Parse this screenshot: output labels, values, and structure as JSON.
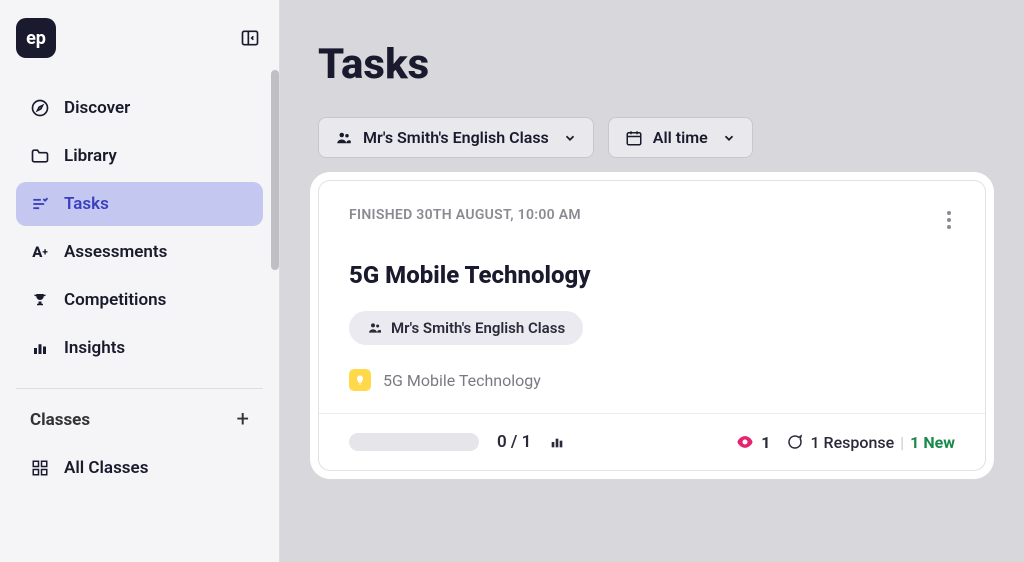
{
  "logo": "ep",
  "sidebar": {
    "items": [
      {
        "label": "Discover"
      },
      {
        "label": "Library"
      },
      {
        "label": "Tasks"
      },
      {
        "label": "Assessments"
      },
      {
        "label": "Competitions"
      },
      {
        "label": "Insights"
      }
    ],
    "classes_header": "Classes",
    "all_classes": "All Classes"
  },
  "page": {
    "title": "Tasks"
  },
  "filters": {
    "class": "Mr's Smith's English Class",
    "time": "All time"
  },
  "task": {
    "finished_line": "FINISHED 30TH AUGUST, 10:00 AM",
    "title": "5G Mobile Technology",
    "class_pill": "Mr's Smith's English Class",
    "topic": "5G Mobile Technology",
    "progress_text": "0 / 1",
    "view_count": "1",
    "response_text": "1 Response",
    "new_text": "1 New"
  }
}
